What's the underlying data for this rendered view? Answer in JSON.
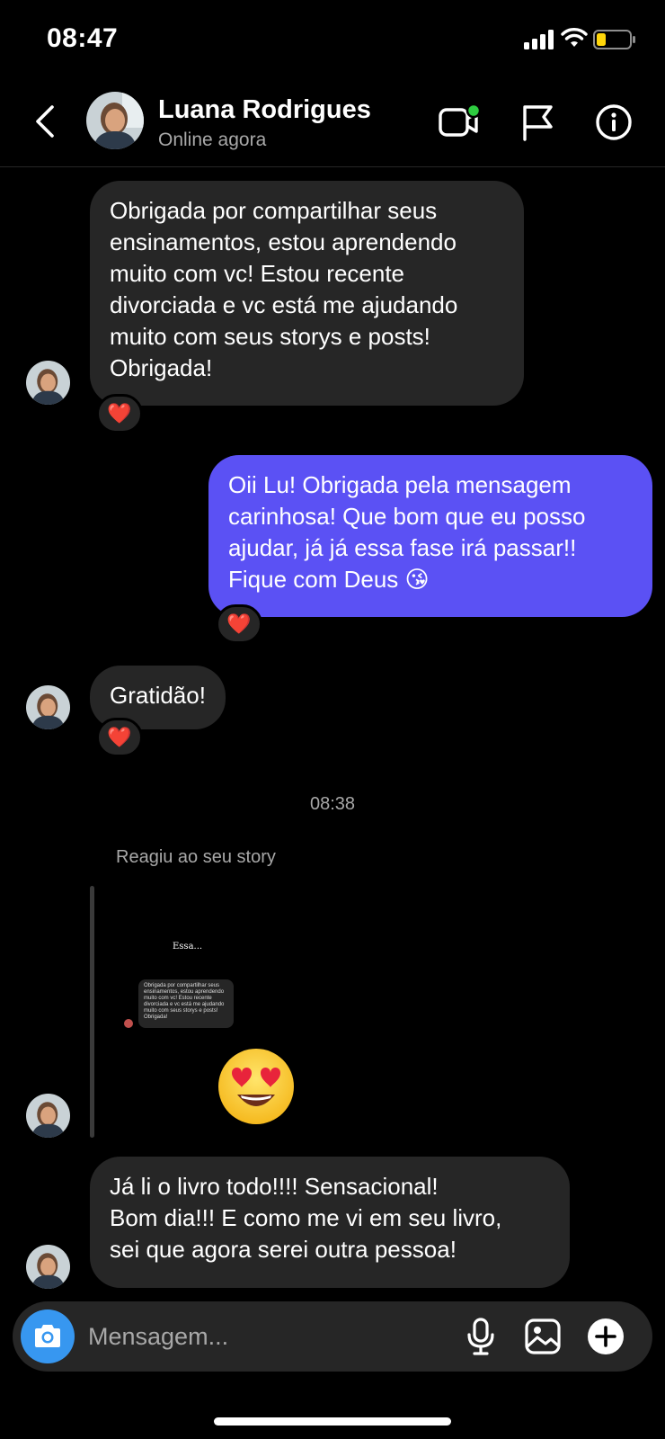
{
  "status_bar": {
    "time": "08:47",
    "battery_color": "#ffd60a"
  },
  "header": {
    "contact_name": "Luana Rodrigues",
    "contact_status": "Online agora",
    "online_dot_color": "#2ecc40"
  },
  "messages": [
    {
      "direction": "in",
      "text": [
        "Obrigada por compartilhar seus",
        "ensinamentos, estou aprendendo",
        "muito com vc! Estou recente",
        "divorciada e vc está me ajudando",
        "muito com seus storys e posts!",
        "Obrigada!"
      ],
      "reaction": "❤️"
    },
    {
      "direction": "out",
      "text": [
        "Oii Lu! Obrigada pela mensagem",
        "carinhosa! Que bom que eu posso",
        "ajudar, já já essa fase irá passar!!",
        "Fique com Deus 😘"
      ],
      "reaction": "❤️"
    },
    {
      "direction": "in",
      "text": [
        "Gratidão!"
      ],
      "reaction": "❤️"
    }
  ],
  "timestamp": "08:38",
  "story_reply": {
    "caption": "Reagiu ao seu story",
    "story_title": "Essa...",
    "story_inner_text": [
      "Obrigada por compartilhar seus",
      "ensinamentos, estou aprendendo",
      "muito com vc! Estou recente",
      "divorciada e vc está me ajudando",
      "muito com seus storys e posts!",
      "Obrigada!"
    ],
    "reaction_emoji": "heart-eyes-emoji"
  },
  "last_message": {
    "direction": "in",
    "text": [
      "Já li o livro todo!!!! Sensacional!",
      "Bom dia!!! E como me vi em seu livro,",
      "sei que agora serei outra pessoa!"
    ]
  },
  "composer": {
    "placeholder": "Mensagem..."
  },
  "colors": {
    "outgoing_bubble": "#5b51f4",
    "incoming_bubble": "#262626",
    "camera_button": "#3797f0"
  }
}
